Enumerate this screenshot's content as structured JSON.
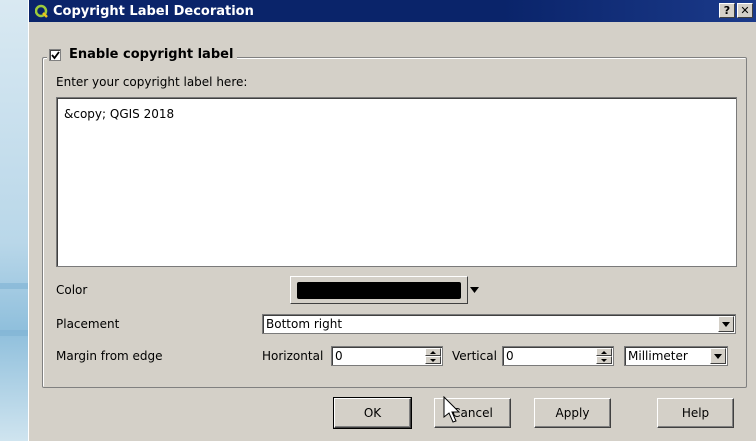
{
  "window": {
    "title": "Copyright Label Decoration",
    "help_label": "?",
    "close_label": "✕"
  },
  "group": {
    "label": "Enable copyright label",
    "enabled": true
  },
  "prompt": "Enter your copyright label here:",
  "label_text": "&copy; QGIS 2018",
  "color": {
    "label": "Color",
    "value": "#000000"
  },
  "placement": {
    "label": "Placement",
    "value": "Bottom right"
  },
  "margin": {
    "label": "Margin from edge",
    "horizontal_label": "Horizontal",
    "horizontal_value": "0",
    "vertical_label": "Vertical",
    "vertical_value": "0",
    "unit": "Millimeter"
  },
  "buttons": {
    "ok": "OK",
    "cancel": "Cancel",
    "apply": "Apply",
    "help": "Help"
  }
}
